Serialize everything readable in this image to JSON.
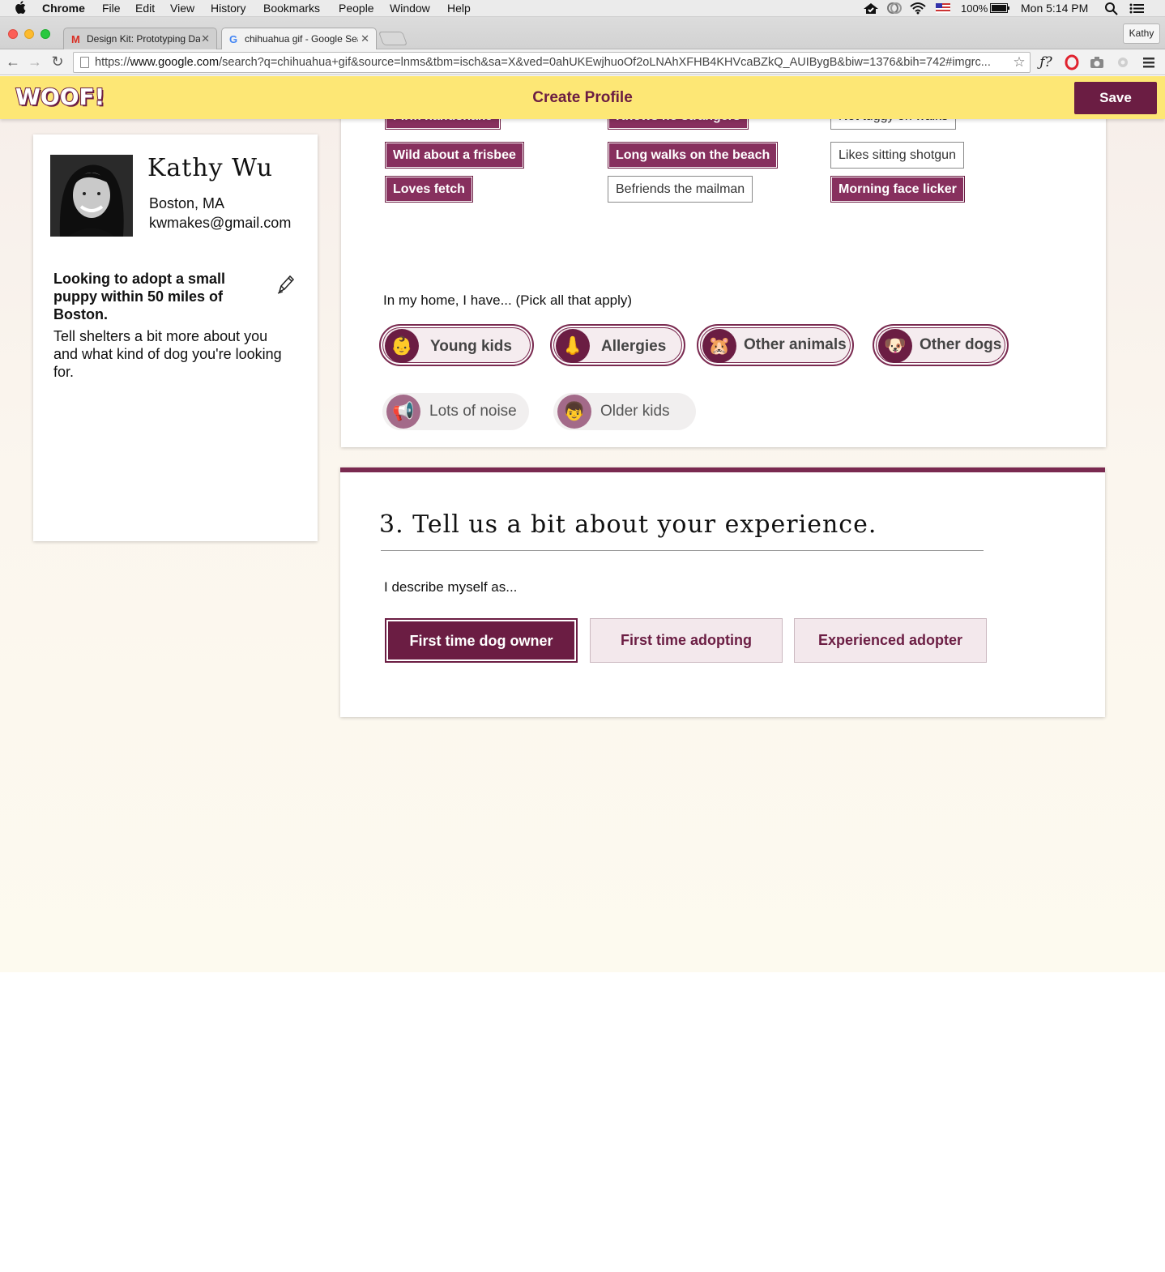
{
  "menubar": {
    "app_name": "Chrome",
    "items": [
      "File",
      "Edit",
      "View",
      "History",
      "Bookmarks",
      "People",
      "Window",
      "Help"
    ],
    "battery": "100%",
    "clock": "Mon 5:14 PM"
  },
  "browser": {
    "tabs": [
      {
        "title": "Design Kit: Prototyping Da",
        "favicon": "M"
      },
      {
        "title": "chihuahua gif - Google Sea",
        "favicon": "G"
      }
    ],
    "profile": "Kathy",
    "url_prefix": "https://",
    "url_domain": "www.google.com",
    "url_rest": "/search?q=chihuahua+gif&source=lnms&tbm=isch&sa=X&ved=0ahUKEwjhuoOf2oLNAhXFHB4KHVcaBZkQ_AUIBygB&biw=1376&bih=742#imgrc..."
  },
  "app": {
    "logo": "WOOF!",
    "title": "Create Profile",
    "save_label": "Save",
    "accent": "#6b1d43",
    "bar_color": "#fde775"
  },
  "profile": {
    "name": "Kathy Wu",
    "location": "Boston, MA",
    "email": "kwmakes@gmail.com",
    "goal": "Looking to adopt a small puppy within 50 miles of Boston.",
    "description": "Tell shelters a bit more about you and what kind of dog you're looking for."
  },
  "traits": [
    {
      "label": "Firm handshake",
      "selected": true
    },
    {
      "label": "Knows no strangers",
      "selected": true
    },
    {
      "label": "Not tuggy on walks",
      "selected": false
    },
    {
      "label": "Wild about a frisbee",
      "selected": true
    },
    {
      "label": "Long walks on the beach",
      "selected": true
    },
    {
      "label": "Likes sitting shotgun",
      "selected": false
    },
    {
      "label": "Loves fetch",
      "selected": true
    },
    {
      "label": "Befriends the mailman",
      "selected": false
    },
    {
      "label": "Morning face licker",
      "selected": true
    }
  ],
  "home": {
    "question": "In my home, I have... (Pick all that apply)",
    "options": [
      {
        "label": "Young kids",
        "emoji": "👶",
        "selected": true
      },
      {
        "label": "Allergies",
        "emoji": "👃",
        "selected": true
      },
      {
        "label": "Other animals",
        "emoji": "🐹",
        "selected": true
      },
      {
        "label": "Other dogs",
        "emoji": "🐶",
        "selected": true
      },
      {
        "label": "Lots of noise",
        "emoji": "📢",
        "selected": false
      },
      {
        "label": "Older kids",
        "emoji": "👦",
        "selected": false
      }
    ]
  },
  "experience": {
    "title": "3. Tell us a bit about your experience.",
    "question": "I describe myself as...",
    "options": [
      {
        "label": "First time dog owner",
        "selected": true
      },
      {
        "label": "First time adopting",
        "selected": false
      },
      {
        "label": "Experienced adopter",
        "selected": false
      }
    ]
  }
}
